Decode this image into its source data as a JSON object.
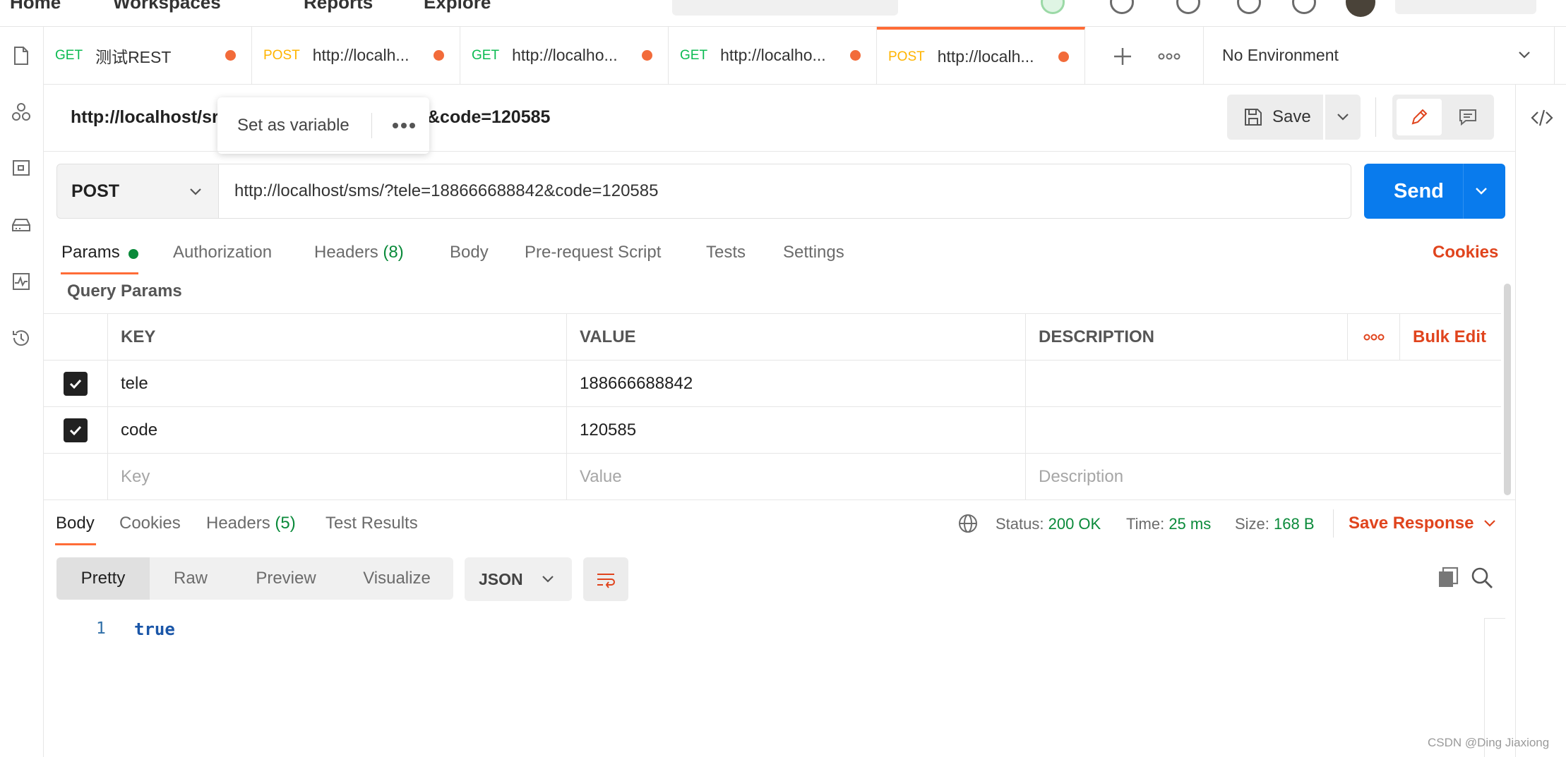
{
  "topnav": {
    "items": [
      "Home",
      "Workspaces",
      "Reports",
      "Explore"
    ]
  },
  "tabs": [
    {
      "method": "GET",
      "name": "测试REST"
    },
    {
      "method": "POST",
      "name": "http://localh..."
    },
    {
      "method": "GET",
      "name": "http://localho..."
    },
    {
      "method": "GET",
      "name": "http://localho..."
    },
    {
      "method": "POST",
      "name": "http://localh...",
      "active": true
    }
  ],
  "environment": {
    "label": "No Environment"
  },
  "request": {
    "title_left": "http://localhost/sr",
    "title_right": "&code=120585",
    "popover_label": "Set as variable",
    "save_label": "Save",
    "method": "POST",
    "url": "http://localhost/sms/?tele=188666688842&code=120585",
    "send_label": "Send"
  },
  "request_tabs": {
    "params": "Params",
    "authorization": "Authorization",
    "headers": "Headers",
    "headers_count": "(8)",
    "body": "Body",
    "prerequest": "Pre-request Script",
    "tests": "Tests",
    "settings": "Settings",
    "cookies": "Cookies"
  },
  "query_params": {
    "title": "Query Params",
    "columns": {
      "key": "KEY",
      "value": "VALUE",
      "description": "DESCRIPTION"
    },
    "bulk_edit": "Bulk Edit",
    "rows": [
      {
        "key": "tele",
        "value": "188666688842",
        "description": "",
        "checked": true
      },
      {
        "key": "code",
        "value": "120585",
        "description": "",
        "checked": true
      }
    ],
    "placeholders": {
      "key": "Key",
      "value": "Value",
      "description": "Description"
    }
  },
  "response": {
    "tabs": {
      "body": "Body",
      "cookies": "Cookies",
      "headers": "Headers",
      "headers_count": "(5)",
      "test_results": "Test Results"
    },
    "status_label": "Status:",
    "status_value": "200 OK",
    "time_label": "Time:",
    "time_value": "25 ms",
    "size_label": "Size:",
    "size_value": "168 B",
    "save_response": "Save Response",
    "formats": [
      "Pretty",
      "Raw",
      "Preview",
      "Visualize"
    ],
    "language": "JSON",
    "body_line_number": "1",
    "body_value": "true"
  },
  "watermark": "CSDN @Ding Jiaxiong",
  "colors": {
    "accent": "#ff6c37",
    "send": "#097bed",
    "success": "#0a8a3a",
    "link": "#e0441d",
    "get": "#0cbb52",
    "post": "#ffb400"
  }
}
